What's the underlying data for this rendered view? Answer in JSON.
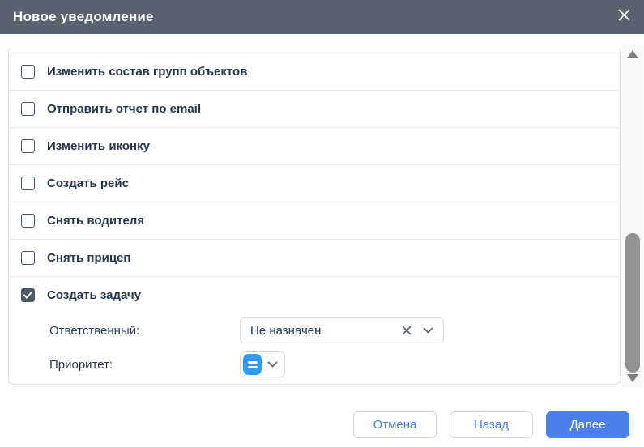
{
  "dialog": {
    "title": "Новое уведомление"
  },
  "list": {
    "items": [
      {
        "label": "Изменить состав групп объектов",
        "checked": false
      },
      {
        "label": "Отправить отчет по email",
        "checked": false
      },
      {
        "label": "Изменить иконку",
        "checked": false
      },
      {
        "label": "Создать рейс",
        "checked": false
      },
      {
        "label": "Снять водителя",
        "checked": false
      },
      {
        "label": "Снять прицеп",
        "checked": false
      },
      {
        "label": "Создать задачу",
        "checked": true
      }
    ]
  },
  "task_fields": {
    "responsible_label": "Ответственный:",
    "responsible_value": "Не назначен",
    "priority_label": "Приоритет:"
  },
  "footer": {
    "cancel": "Отмена",
    "back": "Назад",
    "next": "Далее"
  },
  "colors": {
    "header_bg": "#5a626f",
    "accent_blue": "#4a80e8",
    "priority_icon_blue": "#2e9cf4",
    "text": "#253650",
    "checkbox_checked_bg": "#4d5866"
  },
  "icons": {
    "close-icon": "✕",
    "clear-icon": "✕",
    "chevron-down-icon": "⌄",
    "checkmark-icon": "✓",
    "scroll-up-icon": "▲",
    "scroll-down-icon": "▼",
    "priority-normal-icon": "="
  }
}
